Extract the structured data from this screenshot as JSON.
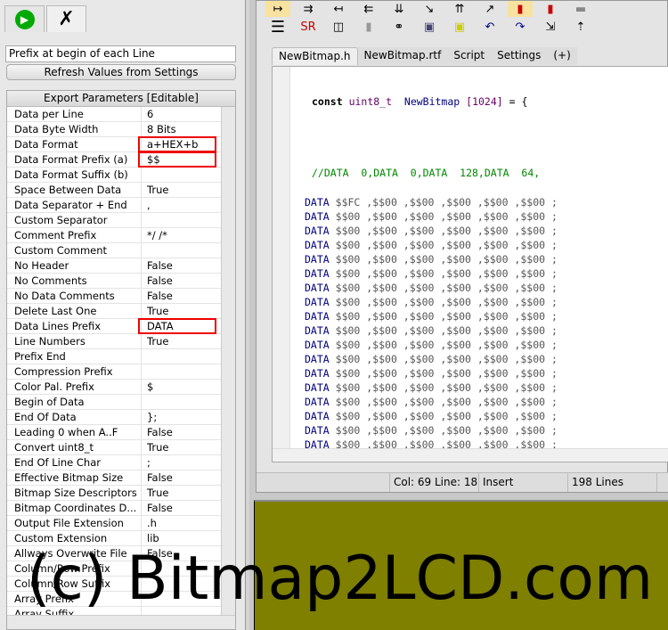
{
  "left": {
    "tabs": [
      {
        "icon": "play-icon"
      },
      {
        "icon": "tools-icon"
      }
    ],
    "description": "Prefix at begin of each Line",
    "refresh_label": "Refresh Values from Settings",
    "grid_title": "Export Parameters [Editable]",
    "rows": [
      {
        "k": "Data per Line",
        "v": "6"
      },
      {
        "k": "Data Byte Width",
        "v": "8 Bits"
      },
      {
        "k": "Data Format",
        "v": "a+HEX+b",
        "hl": true
      },
      {
        "k": "Data Format Prefix (a)",
        "v": "$$",
        "hl": true
      },
      {
        "k": "Data Format Suffix (b)",
        "v": ""
      },
      {
        "k": "Space Between Data",
        "v": "True"
      },
      {
        "k": "Data Separator + End",
        "v": ","
      },
      {
        "k": "Custom Separator",
        "v": ""
      },
      {
        "k": "Comment Prefix",
        "v": "*/ /*"
      },
      {
        "k": "Custom Comment",
        "v": ""
      },
      {
        "k": "No Header",
        "v": "False"
      },
      {
        "k": "No Comments",
        "v": "False"
      },
      {
        "k": "No Data Comments",
        "v": "False"
      },
      {
        "k": "Delete Last One",
        "v": "True"
      },
      {
        "k": "Data Lines Prefix",
        "v": "DATA",
        "hl": true
      },
      {
        "k": "Line Numbers",
        "v": "True"
      },
      {
        "k": "Prefix End",
        "v": ""
      },
      {
        "k": "Compression Prefix",
        "v": ""
      },
      {
        "k": "Color Pal. Prefix",
        "v": "$"
      },
      {
        "k": "Begin of Data",
        "v": ""
      },
      {
        "k": "End Of Data",
        "v": "};"
      },
      {
        "k": "Leading 0 when A..F",
        "v": "False"
      },
      {
        "k": "Convert uint8_t",
        "v": "True"
      },
      {
        "k": "End Of Line Char",
        "v": " ;"
      },
      {
        "k": "Effective Bitmap Size",
        "v": "False"
      },
      {
        "k": "Bitmap Size Descriptors",
        "v": "True"
      },
      {
        "k": "Bitmap Coordinates D...",
        "v": "False"
      },
      {
        "k": "Output File Extension",
        "v": ".h"
      },
      {
        "k": "Custom Extension",
        "v": "lib"
      },
      {
        "k": "Allways Overwrite File",
        "v": "False"
      },
      {
        "k": "Column/Row Prefix",
        "v": ""
      },
      {
        "k": "Column/Row Suffix",
        "v": ""
      },
      {
        "k": "Array Prefix",
        "v": ""
      },
      {
        "k": "Array Suffix",
        "v": ""
      }
    ]
  },
  "editor": {
    "tabs": [
      "NewBitmap.h",
      "NewBitmap.rtf",
      "Script",
      "Settings",
      "(+)"
    ],
    "decl": {
      "kw": "const",
      "type": "uint8_t",
      "name": "NewBitmap",
      "size": "1024",
      "rest": "= {"
    },
    "comment": "//DATA  0,DATA  0,DATA  128,DATA  64,",
    "lines": [
      "$$FC ,$$00 ,$$00 ,$$00 ,$$00 ,$$00 ;",
      "$$00 ,$$00 ,$$00 ,$$00 ,$$00 ,$$00 ;",
      "$$00 ,$$00 ,$$00 ,$$00 ,$$00 ,$$00 ;",
      "$$00 ,$$00 ,$$00 ,$$00 ,$$00 ,$$00 ;",
      "$$00 ,$$00 ,$$00 ,$$00 ,$$00 ,$$00 ;",
      "$$00 ,$$00 ,$$00 ,$$00 ,$$00 ,$$00 ;",
      "$$00 ,$$00 ,$$00 ,$$00 ,$$00 ,$$00 ;",
      "$$00 ,$$00 ,$$00 ,$$00 ,$$00 ,$$00 ;",
      "$$00 ,$$00 ,$$00 ,$$00 ,$$00 ,$$00 ;",
      "$$00 ,$$00 ,$$00 ,$$00 ,$$00 ,$$00 ;",
      "$$00 ,$$00 ,$$00 ,$$00 ,$$00 ,$$00 ;",
      "$$00 ,$$00 ,$$00 ,$$00 ,$$00 ,$$00 ;",
      "$$00 ,$$00 ,$$00 ,$$00 ,$$00 ,$$00 ;",
      "$$00 ,$$00 ,$$00 ,$$00 ,$$00 ,$$00 ;",
      "$$00 ,$$00 ,$$00 ,$$00 ,$$00 ,$$00 ;",
      "$$00 ,$$00 ,$$00 ,$$00 ,$$00 ,$$00 ;",
      "$$00 ,$$00 ,$$00 ,$$00 ,$$00 ,$$00 ;",
      "$$00 ,$$00 ,$$00 ,$$00 ,$$00 ,$$00 ;"
    ],
    "line_prefix": "DATA"
  },
  "status": {
    "pos": "Col: 69 Line: 18",
    "mode": "Insert",
    "lines": "198 Lines"
  },
  "watermark": "(c) Bitmap2LCD.com",
  "colors": {
    "olive": "#7f7f00",
    "highlight": "#e00000",
    "keyword": "#000080",
    "comment": "#008000"
  }
}
